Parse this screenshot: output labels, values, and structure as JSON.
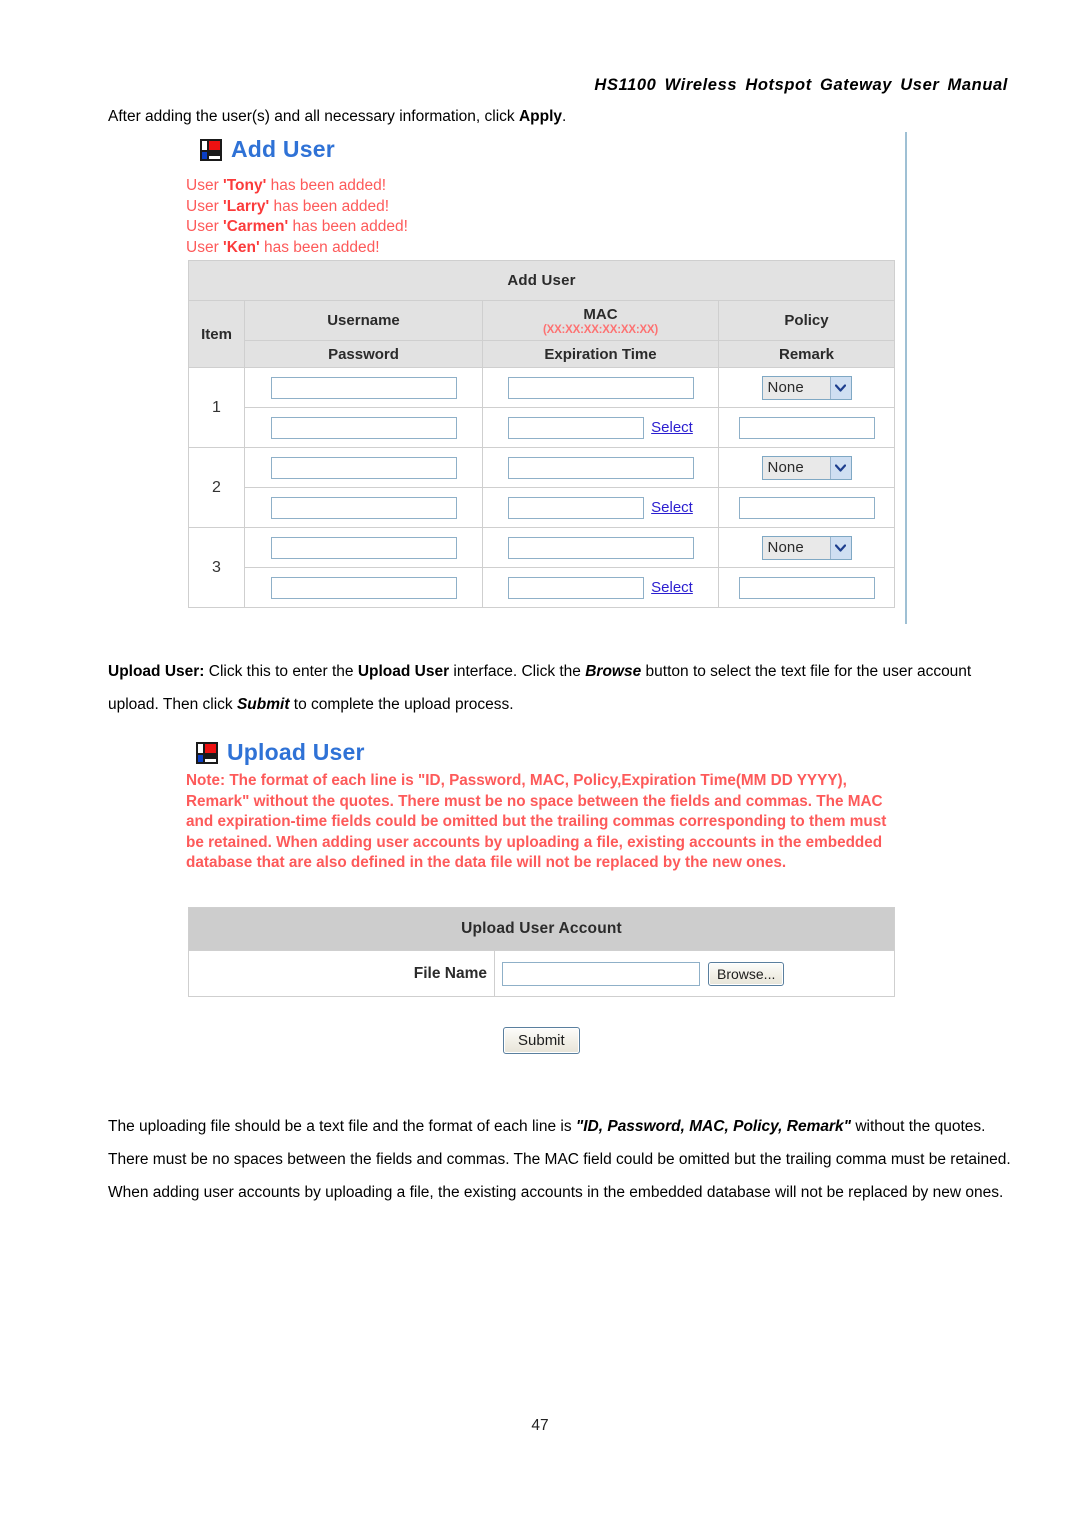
{
  "document": {
    "running_header": "HS1100 Wireless Hotspot Gateway User Manual",
    "page_number": "47"
  },
  "paragraphs": {
    "intro_prefix": "After adding the user(s) and all necessary information, click ",
    "intro_bold": "Apply",
    "intro_suffix": ".",
    "upload_desc_label": "Upload User:",
    "upload_desc_part1": " Click this to enter the ",
    "upload_desc_bold1": "Upload User",
    "upload_desc_part2": " interface. Click the ",
    "upload_desc_bold2": "Browse",
    "upload_desc_part3": " button to select the text file for the user account upload. Then click ",
    "upload_desc_bold3": "Submit",
    "upload_desc_part4": " to complete the upload process.",
    "format_part1": "The uploading file should be a text file and the format of each line is ",
    "format_bold": "\"ID, Password, MAC, Policy, Remark\"",
    "format_part2": " without the quotes. There must be no spaces between the fields and commas. The MAC field could be omitted but the trailing comma must be retained. When adding user accounts by uploading a file, the existing accounts in the embedded database will not be replaced by new ones."
  },
  "add_user_screen": {
    "icon": "mondrian-icon",
    "title": "Add User",
    "status_messages": [
      {
        "prefix": "User ",
        "user": "'Tony'",
        "suffix": " has been added!"
      },
      {
        "prefix": "User ",
        "user": "'Larry'",
        "suffix": " has been added!"
      },
      {
        "prefix": "User ",
        "user": "'Carmen'",
        "suffix": " has been added!"
      },
      {
        "prefix": "User ",
        "user": "'Ken'",
        "suffix": " has been added!"
      }
    ],
    "table": {
      "caption": "Add User",
      "headers": {
        "item": "Item",
        "username": "Username",
        "mac": "MAC",
        "mac_hint": "(XX:XX:XX:XX:XX:XX)",
        "policy": "Policy",
        "password": "Password",
        "expiration_time": "Expiration Time",
        "remark": "Remark"
      },
      "select_link_label": "Select",
      "policy_selected": "None",
      "policy_options": [
        "None"
      ],
      "rows": [
        {
          "item": "1",
          "username_value": "",
          "mac_value": "",
          "policy_value": "None",
          "password_value": "",
          "expiration_value": "",
          "remark_value": ""
        },
        {
          "item": "2",
          "username_value": "",
          "mac_value": "",
          "policy_value": "None",
          "password_value": "",
          "expiration_value": "",
          "remark_value": ""
        },
        {
          "item": "3",
          "username_value": "",
          "mac_value": "",
          "policy_value": "None",
          "password_value": "",
          "expiration_value": "",
          "remark_value": ""
        }
      ]
    }
  },
  "upload_user_screen": {
    "icon": "mondrian-icon",
    "title": "Upload User",
    "note": "Note: The format of each line is \"ID, Password, MAC, Policy,Expiration Time(MM DD YYYY), Remark\" without the quotes. There must be no space between the fields and commas. The MAC and expiration-time fields could be omitted but the trailing commas corresponding to them must be retained. When adding user accounts by uploading a file, existing accounts in the embedded database that are also defined in the data file will not be replaced by the new ones.",
    "panel_title": "Upload User Account",
    "file_name_label": "File Name",
    "file_name_value": "",
    "browse_button": "Browse...",
    "submit_button": "Submit"
  },
  "colors": {
    "link": "#2b1ed0",
    "title_blue": "#2f72d6",
    "status_red": "#fd5a5a",
    "header_gray": "#e2e2e2",
    "panel_gray": "#cdcdcd",
    "input_border": "#8fb0c8"
  }
}
